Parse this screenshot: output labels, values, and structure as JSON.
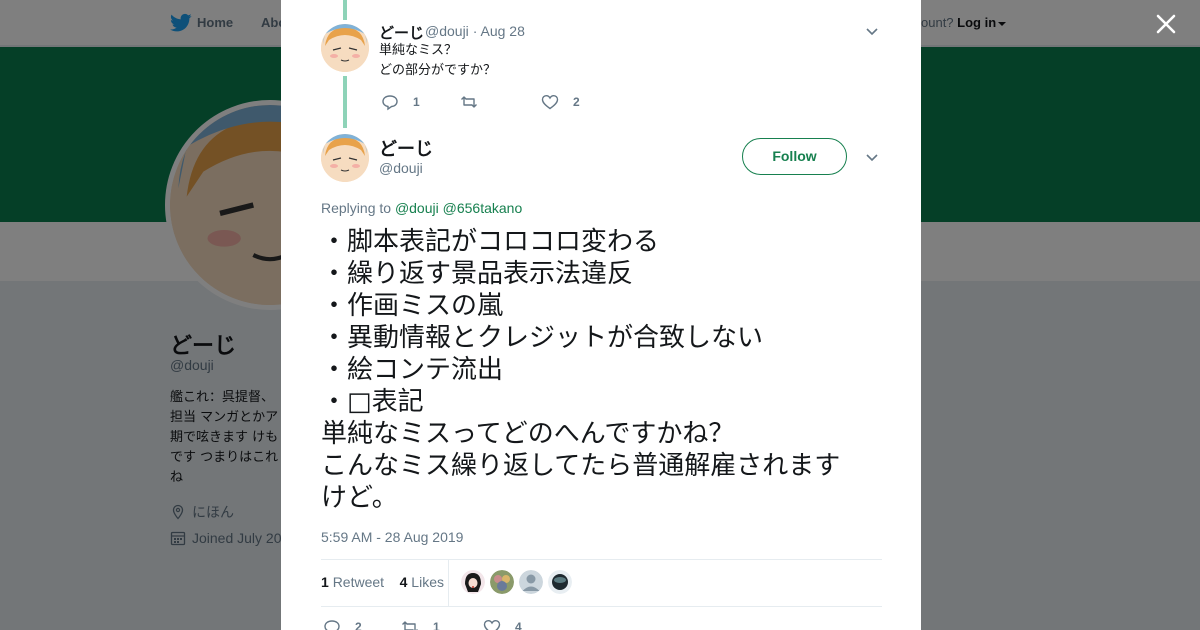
{
  "topnav": {
    "home_label": "Home",
    "about_label": "Abo",
    "account_prompt": "ccount?",
    "login_label": "Log in"
  },
  "profile": {
    "name": "どーじ",
    "handle": "@douji",
    "bio_lines": [
      "艦これ：呉提督、",
      "担当 マンガとかア",
      "期で呟きます けも",
      "です つまりはこれ",
      "ね"
    ],
    "location": "にほん",
    "joined": "Joined July 20"
  },
  "colors": {
    "accent": "#17804f",
    "banner": "#0a7f4f",
    "thread_line": "#8ed3b8",
    "meta_text": "#657786"
  },
  "parent_tweet": {
    "name": "どーじ",
    "handle": "@douji",
    "dot": "·",
    "date": "Aug 28",
    "lines": [
      "単純なミス？",
      "どの部分がですか？"
    ],
    "reply_count": "1",
    "retweet_count": "",
    "like_count": "2"
  },
  "main_tweet": {
    "name": "どーじ",
    "handle": "@douji",
    "follow_label": "Follow",
    "replying_prefix": "Replying to",
    "replying_to": [
      "@douji",
      "@656takano"
    ],
    "lines": [
      "・脚本表記がコロコロ変わる",
      "・繰り返す景品表示法違反",
      "・作画ミスの嵐",
      "・異動情報とクレジットが合致しない",
      "・絵コンテ流出",
      "・□表記",
      "単純なミスってどのへんですかね？",
      "こんなミス繰り返してたら普通解雇されます",
      "けど。"
    ],
    "timestamp": "5:59 AM - 28 Aug 2019",
    "retweets_num": "1",
    "retweets_label": "Retweet",
    "likes_num": "4",
    "likes_label": "Likes",
    "reply_count": "2",
    "retweet_count": "1",
    "like_count": "4"
  },
  "icons": [
    "twitter-bird-icon",
    "close-icon",
    "chevron-down-icon",
    "reply-icon",
    "retweet-icon",
    "heart-icon",
    "location-pin-icon",
    "calendar-icon"
  ]
}
